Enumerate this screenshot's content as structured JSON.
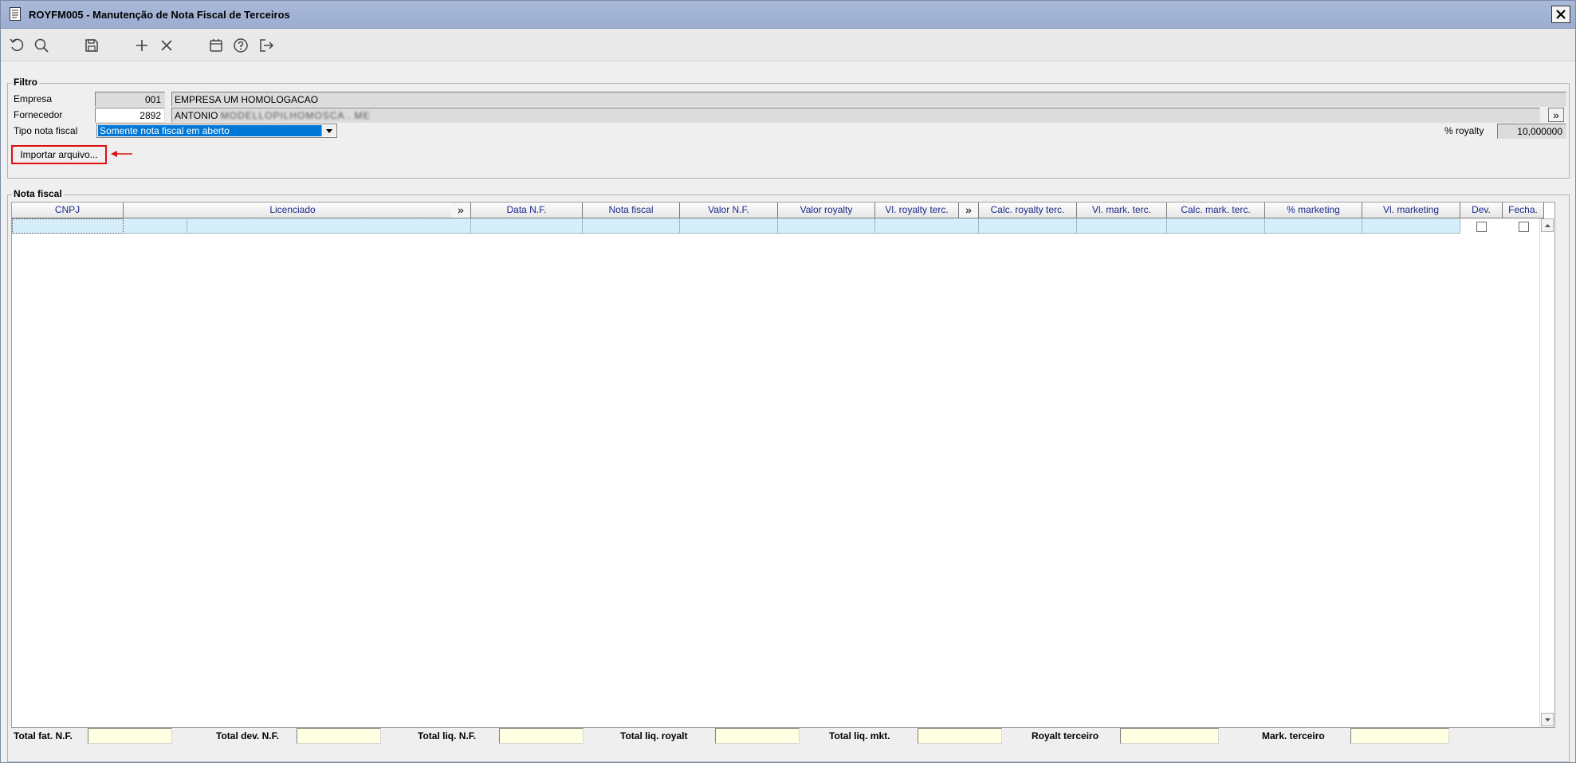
{
  "window": {
    "title": "ROYFM005 - Manutenção de Nota Fiscal de Terceiros",
    "close_label": "✕"
  },
  "toolbar": {
    "icons": [
      "undo-icon",
      "search-icon",
      "save-icon",
      "add-icon",
      "delete-icon",
      "calendar-icon",
      "help-icon",
      "exit-icon"
    ]
  },
  "filtro": {
    "legend": "Filtro",
    "empresa": {
      "label": "Empresa",
      "code": "001",
      "name": "EMPRESA UM HOMOLOGACAO"
    },
    "fornecedor": {
      "label": "Fornecedor",
      "code": "2892",
      "name_prefix": "ANTONIO",
      "name_blurred": "MODELLOPILHOMOSCA",
      "name_suffix": ". ME"
    },
    "tipo": {
      "label": "Tipo nota fiscal",
      "value": "Somente nota fiscal em aberto"
    },
    "royalty": {
      "label": "% royalty",
      "value": "10,000000"
    },
    "import_button": "Importar arquivo...",
    "more_symbol": "»"
  },
  "nota_fiscal": {
    "legend": "Nota fiscal",
    "columns": [
      "CNPJ",
      "Licenciado",
      "»",
      "Data N.F.",
      "Nota fiscal",
      "Valor N.F.",
      "Valor royalty",
      "Vl. royalty terc.",
      "»",
      "Calc. royalty terc.",
      "Vl. mark. terc.",
      "Calc. mark. terc.",
      "% marketing",
      "Vl. marketing",
      "Dev.",
      "Fecha."
    ]
  },
  "totals": {
    "total_fat": "Total fat. N.F.",
    "total_dev": "Total dev. N.F.",
    "total_liq_nf": "Total liq. N.F.",
    "total_liq_royalt": "Total liq. royalt",
    "total_liq_mkt": "Total liq. mkt.",
    "royalt_terceiro": "Royalt terceiro",
    "mark_terceiro": "Mark. terceiro"
  },
  "colors": {
    "titlebar": "#a9b9d9",
    "selection": "#0078d7",
    "row_highlight": "#d6eef9",
    "total_field": "#ffffe1",
    "callout": "#dd1111"
  }
}
